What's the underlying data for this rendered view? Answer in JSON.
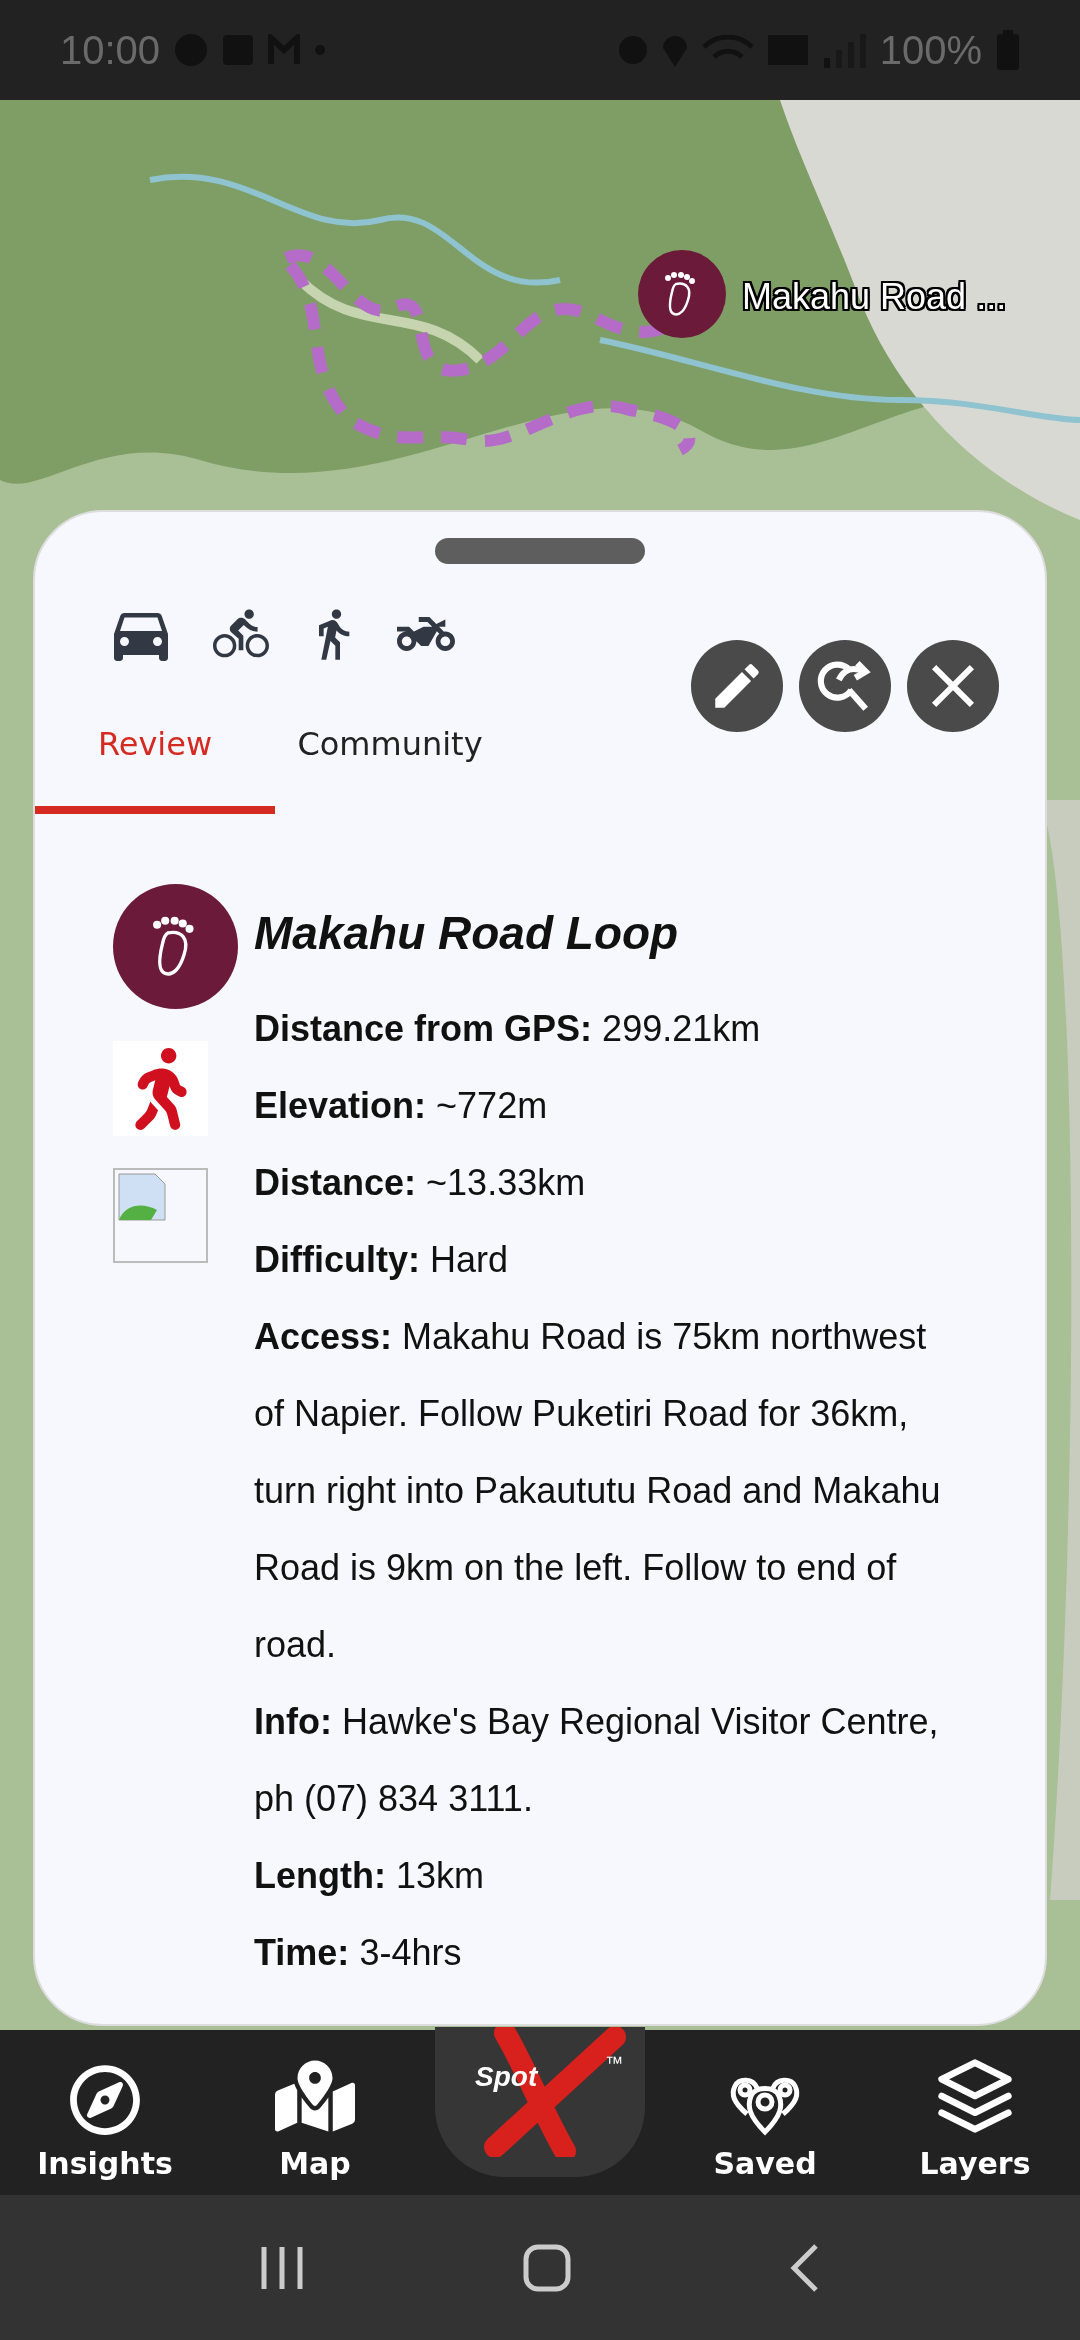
{
  "status_bar": {
    "time": "10:00",
    "battery": "100%"
  },
  "map": {
    "marker_label": "Makahu Road ..."
  },
  "panel": {
    "tabs": [
      {
        "label": "Review",
        "selected": true
      },
      {
        "label": "Community",
        "selected": false
      }
    ],
    "trail": {
      "title": "Makahu Road Loop",
      "details": [
        {
          "label": "Distance from GPS:",
          "value": "299.21km"
        },
        {
          "label": "Elevation:",
          "value": "~772m"
        },
        {
          "label": "Distance:",
          "value": "~13.33km"
        },
        {
          "label": "Difficulty:",
          "value": "Hard"
        },
        {
          "label": "Access:",
          "value": "Makahu Road is 75km northwest of Napier. Follow Puketiri Road for 36km, turn right into Pakaututu Road and Makahu Road is 9km on the left. Follow to end of road."
        },
        {
          "label": "Info:",
          "value": "Hawke's Bay Regional Visitor Centre, ph (07) 834 3111."
        },
        {
          "label": "Length:",
          "value": "13km"
        },
        {
          "label": "Time:",
          "value": "3-4hrs"
        }
      ]
    }
  },
  "bottom_nav": {
    "items": [
      {
        "kind": "insights",
        "label": "Insights"
      },
      {
        "kind": "map",
        "label": "Map"
      },
      {
        "kind": "logo",
        "label": "Spot",
        "mark": "™"
      },
      {
        "kind": "saved",
        "label": "Saved"
      },
      {
        "kind": "layers",
        "label": "Layers"
      }
    ]
  }
}
